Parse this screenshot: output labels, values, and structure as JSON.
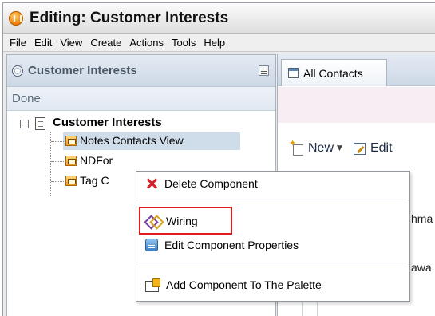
{
  "window": {
    "title": "Editing: Customer Interests"
  },
  "menubar": {
    "items": [
      "File",
      "Edit",
      "View",
      "Create",
      "Actions",
      "Tools",
      "Help"
    ]
  },
  "left_panel": {
    "title": "Customer Interests",
    "done_label": "Done",
    "tree": {
      "root": "Customer Interests",
      "children": [
        "Notes Contacts View",
        "NDFor",
        "Tag C"
      ]
    }
  },
  "right_panel": {
    "tab_label": "All Contacts",
    "toolbar": {
      "new_label": "New",
      "edit_label": "Edit"
    },
    "partial_texts": [
      "hma",
      "awa"
    ]
  },
  "context_menu": {
    "items": [
      {
        "label": "Delete Component",
        "icon": "delete-x-icon"
      },
      {
        "label": "Wiring",
        "icon": "wiring-icon",
        "highlighted": true
      },
      {
        "label": "Edit Component Properties",
        "icon": "properties-icon"
      },
      {
        "label": "Add Component To The Palette",
        "icon": "add-to-palette-icon"
      }
    ]
  },
  "colors": {
    "highlight_border": "#e01b1b",
    "selection": "#cfdce9",
    "panel_header": "#cdd8e6"
  }
}
